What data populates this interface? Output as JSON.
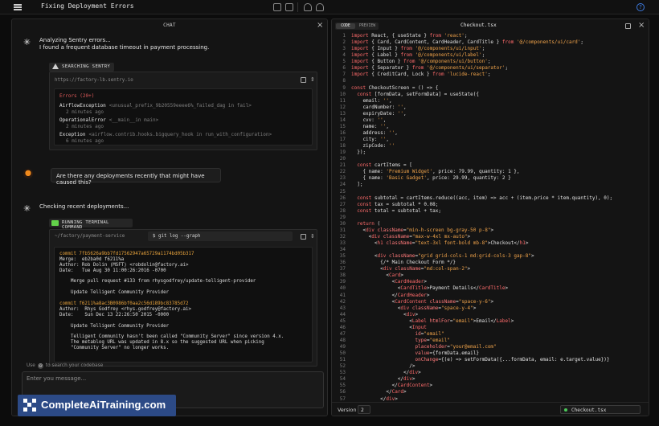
{
  "app": {
    "title": "Fixing Deployment Errors",
    "help_icon": "?"
  },
  "chat": {
    "title": "CHAT",
    "messages": {
      "m1_line1": "Analyzing Sentry errors...",
      "m1_line2": "I found a frequent database timeout in payment processing.",
      "sentry_badge": "SEARCHING SENTRY",
      "sentry_url": "https://factory-lb.sentry.io",
      "errors_header": "Errors (20+)",
      "errors": [
        {
          "name": "AirflowException",
          "detail": "<unusual_prefix_9b20559eeee6%_failed_dag in fail>",
          "time": "2 minutes ago"
        },
        {
          "name": "OperationalError",
          "detail": "<__main__in main>",
          "time": "2 minutes ago"
        },
        {
          "name": "Exception",
          "detail": "<airflow.contrib.hooks.bigquery_hook in run_with_configuration>",
          "time": "6 minutes ago"
        }
      ],
      "user_msg": "Are there any deployments recently that might have caused this?",
      "m2": "Checking recent deployments...",
      "terminal_badge": "RUNNING TERMINAL COMMAND",
      "terminal_path": "~/factory/payment-service",
      "terminal_cmd": "$ git log --graph",
      "terminal_lines": [
        {
          "t": "commit 7fb5626a9bb7fd17562947a65729a1174bd05b317",
          "c": "y"
        },
        {
          "t": "Merge:  eb2ba0d f6211%a",
          "c": ""
        },
        {
          "t": "Author: Rob Dolin (MSFT) <robdolin@factory.ai>",
          "c": ""
        },
        {
          "t": "Date:   Tue Aug 30 11:00:26:2016 -0700",
          "c": ""
        },
        {
          "t": "",
          "c": ""
        },
        {
          "t": "    Merge pull request #133 from rhysgodfrey/update-telligent-provider",
          "c": ""
        },
        {
          "t": "",
          "c": ""
        },
        {
          "t": "    Update Telligent Community Provider",
          "c": ""
        },
        {
          "t": "",
          "c": ""
        },
        {
          "t": "commit f6211%a8ac3B0986bf0aa2c56d189bc83785d72",
          "c": "y"
        },
        {
          "t": "Author:  Rhys Godfrey <rhys.godfrey@factory.ai>",
          "c": ""
        },
        {
          "t": "Date:    Sun Dec 13 22:26:50 2015 -0000",
          "c": ""
        },
        {
          "t": "",
          "c": ""
        },
        {
          "t": "    Update Telligent Community Provider",
          "c": ""
        },
        {
          "t": "",
          "c": ""
        },
        {
          "t": "    Telligent Community hasn't been called \"Community Server\" since version 4.x.",
          "c": ""
        },
        {
          "t": "    The metablog URL was updated in 8.x so the suggested URL when picking",
          "c": ""
        },
        {
          "t": "    \"Community Server\" no longer works.",
          "c": ""
        }
      ]
    },
    "context_hint_pre": "Use",
    "context_hint_post": "to search your codebase",
    "input_placeholder": "Enter you message..."
  },
  "editor": {
    "tab_code": "CODE",
    "tab_preview": "PREVIEW",
    "filename": "Checkout.tsx",
    "version_label": "Version",
    "version_value": "2",
    "file_chip": "Checkout.tsx",
    "lines": [
      "import React, { useState } from 'react';",
      "import { Card, CardContent, CardHeader, CardTitle } from '@/components/ui/card';",
      "import { Input } from '@/components/ui/input';",
      "import { Label } from '@/components/ui/label';",
      "import { Button } from '@/components/ui/button';",
      "import { Separator } from '@/components/ui/separator';",
      "import { CreditCard, Lock } from 'lucide-react';",
      "",
      "const CheckoutScreen = () => {",
      "  const [formData, setFormData] = useState({",
      "    email: '',",
      "    cardNumber: '',",
      "    expiryDate: '',",
      "    cvv: '',",
      "    name: '',",
      "    address: '',",
      "    city: '',",
      "    zipCode: ''",
      "  });",
      "",
      "  const cartItems = [",
      "    { name: 'Premium Widget', price: 79.99, quantity: 1 },",
      "    { name: 'Basic Gadget', price: 29.99, quantity: 2 }",
      "  ];",
      "",
      "  const subtotal = cartItems.reduce((acc, item) => acc + (item.price * item.quantity), 0);",
      "  const tax = subtotal * 0.08;",
      "  const total = subtotal + tax;",
      "",
      "  return (",
      "    <div className=\"min-h-screen bg-gray-50 p-8\">",
      "      <div className=\"max-w-4xl mx-auto\">",
      "        <h1 className=\"text-3xl font-bold mb-8\">Checkout</h1>",
      "",
      "        <div className=\"grid grid-cols-1 md:grid-cols-3 gap-8\">",
      "          {/* Main Checkout Form */}",
      "          <div className=\"md:col-span-2\">",
      "            <Card>",
      "              <CardHeader>",
      "                <CardTitle>Payment Details</CardTitle>",
      "              </CardHeader>",
      "              <CardContent className=\"space-y-6\">",
      "                <div className=\"space-y-4\">",
      "                  <div>",
      "                    <Label htmlFor=\"email\">Email</Label>",
      "                    <Input",
      "                      id=\"email\"",
      "                      type=\"email\"",
      "                      placeholder=\"your@email.com\"",
      "                      value={formData.email}",
      "                      onChange={(e) => setFormData({...formData, email: e.target.value})}",
      "                    />",
      "                  </div>",
      "                </div>",
      "              </CardContent>",
      "            </Card>",
      "          </div>"
    ]
  },
  "watermark": {
    "text": "CompleteAiTraining.com"
  }
}
